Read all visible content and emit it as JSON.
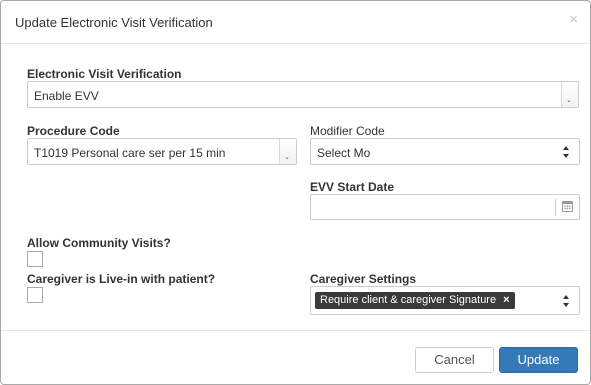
{
  "dialog": {
    "title": "Update Electronic Visit Verification",
    "close_glyph": "×"
  },
  "evv": {
    "label": "Electronic Visit Verification",
    "value": "Enable EVV",
    "arrow": "⌄"
  },
  "procedure_code": {
    "label": "Procedure Code",
    "value": "T1019 Personal care ser per 15 min",
    "arrow": "⌄"
  },
  "modifier_code": {
    "label": "Modifier Code",
    "value": "Select Mo"
  },
  "evv_start_date": {
    "label": "EVV Start Date",
    "value": "",
    "icon": "calendar-icon"
  },
  "community_visits": {
    "label": "Allow Community Visits?",
    "checked": false
  },
  "live_in": {
    "label": "Caregiver is Live-in with patient?",
    "checked": false
  },
  "caregiver_settings": {
    "label": "Caregiver Settings",
    "tags": [
      "Require client & caregiver Signature"
    ],
    "tag_remove_glyph": "×"
  },
  "footer": {
    "cancel_label": "Cancel",
    "update_label": "Update"
  },
  "colors": {
    "primary": "#337ab7",
    "tag_bg": "#3a3a3a",
    "border": "#cccccc"
  }
}
